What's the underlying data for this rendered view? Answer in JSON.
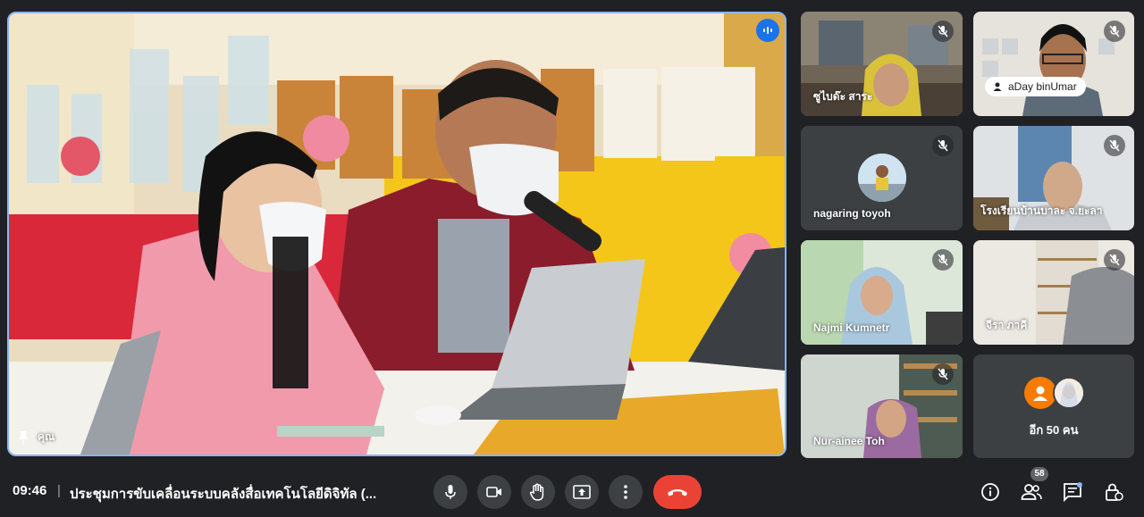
{
  "main_tile": {
    "name": "คุณ"
  },
  "tiles": [
    {
      "name": "ซูไบด๊ะ สาระ"
    },
    {
      "name": "aDay binUmar"
    },
    {
      "name": "nagaring toyoh"
    },
    {
      "name": "โรงเรียนบ้านบาละ จ.ยะลา"
    },
    {
      "name": "Najmi Kumnetr"
    },
    {
      "name": "จีรา ภาคี"
    },
    {
      "name": "Nur-ainee Toh"
    }
  ],
  "others_tile": {
    "label": "อีก 50 คน"
  },
  "bottom_bar": {
    "time": "09:46",
    "separator": "|",
    "meeting_title": "ประชุมการขับเคลื่อนระบบคลังสื่อเทคโนโลยีดิจิทัล (...",
    "participant_count": "58"
  },
  "colors": {
    "accent": "#8ab4f8",
    "end_call": "#ea4335",
    "speaking": "#1a73e8"
  },
  "icons": [
    "speaking-icon",
    "mic-off-icon",
    "pin-icon",
    "mic-icon",
    "camera-icon",
    "raise-hand-icon",
    "present-icon",
    "more-icon",
    "end-call-icon",
    "info-icon",
    "people-icon",
    "chat-icon",
    "host-controls-icon"
  ]
}
